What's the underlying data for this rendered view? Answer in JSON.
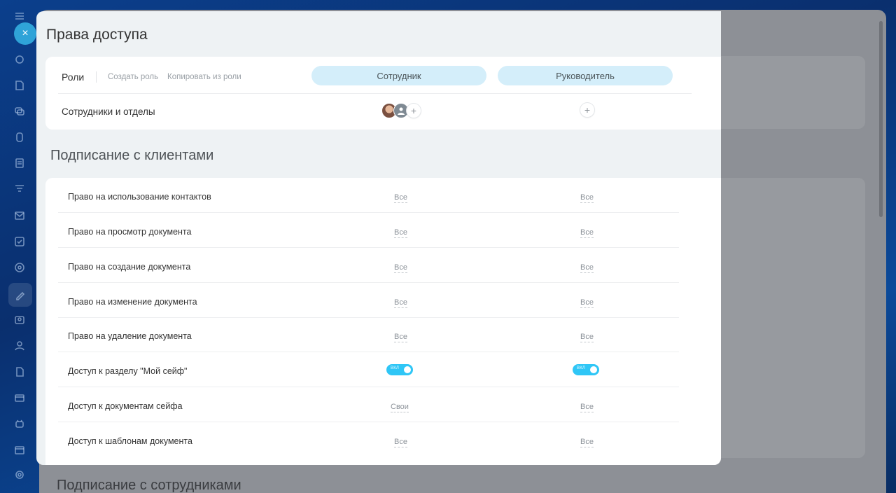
{
  "window": {
    "title": "Права доступа"
  },
  "roles": {
    "label": "Роли",
    "create_link": "Создать роль",
    "copy_link": "Копировать из роли",
    "columns": [
      "Сотрудник",
      "Руководитель"
    ]
  },
  "staff": {
    "label": "Сотрудники и отделы",
    "add_symbol": "+"
  },
  "section": {
    "title": "Подписание с клиентами",
    "rows": [
      {
        "label": "Право на использование контактов",
        "values": [
          "Все",
          "Все"
        ]
      },
      {
        "label": "Право на просмотр документа",
        "values": [
          "Все",
          "Все"
        ]
      },
      {
        "label": "Право на создание документа",
        "values": [
          "Все",
          "Все"
        ]
      },
      {
        "label": "Право на изменение документа",
        "values": [
          "Все",
          "Все"
        ]
      },
      {
        "label": "Право на удаление документа",
        "values": [
          "Все",
          "Все"
        ]
      },
      {
        "label": "Доступ к разделу \"Мой сейф\"",
        "toggle": true,
        "toggle_label": "ВКЛ",
        "values": [
          "",
          ""
        ]
      },
      {
        "label": "Доступ к документам сейфа",
        "values": [
          "Свои",
          "Все"
        ]
      },
      {
        "label": "Доступ к шаблонам документа",
        "values": [
          "Все",
          "Все"
        ]
      }
    ]
  },
  "background": {
    "next_section_title": "Подписание с сотрудниками"
  },
  "close_symbol": "×",
  "colors": {
    "accent": "#2fc6f6",
    "pill": "#d4eefa",
    "close": "#2fa3d8"
  }
}
